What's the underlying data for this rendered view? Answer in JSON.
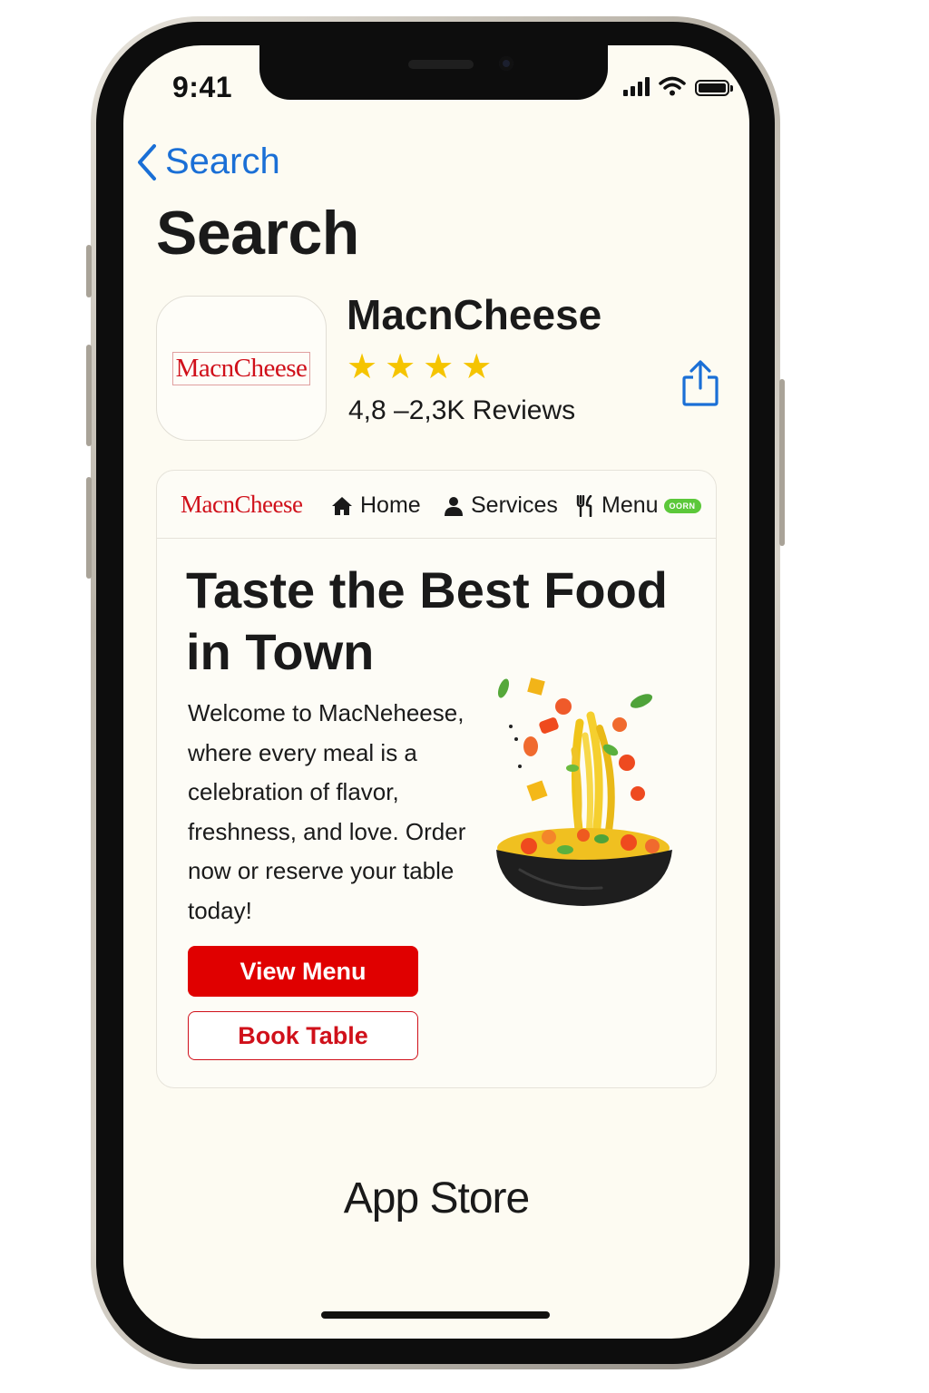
{
  "status_bar": {
    "time": "9:41"
  },
  "nav": {
    "back_label": "Search"
  },
  "page": {
    "title": "Search"
  },
  "app": {
    "icon_logo_text": "MacnCheese",
    "name": "MacnCheese",
    "rating_stars": 4,
    "reviews_text": "4,8 –2,3K Reviews"
  },
  "website": {
    "logo_text": "MacnCheese",
    "nav": {
      "home": "Home",
      "services": "Services",
      "menu": "Menu",
      "menu_badge": "OORN"
    },
    "hero_title": "Taste the Best Food in Town",
    "hero_description": "Welcome to MacNeheese, where every meal is a celebration of flavor, freshness, and love. Order now or reserve your table today!",
    "view_menu_label": "View Menu",
    "book_table_label": "Book Table"
  },
  "footer": {
    "label": "App Store"
  },
  "colors": {
    "accent_blue": "#1a6fd6",
    "brand_red": "#e00000",
    "star_yellow": "#f5c400",
    "badge_green": "#5cc83a",
    "screen_bg": "#fdfbf2"
  },
  "icons": [
    "chevron-left-icon",
    "share-icon",
    "home-icon",
    "person-icon",
    "utensils-icon",
    "star-icon",
    "wifi-icon",
    "signal-icon",
    "battery-icon"
  ]
}
